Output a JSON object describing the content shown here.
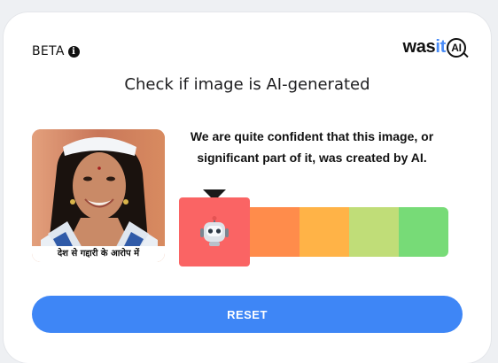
{
  "header": {
    "beta_label": "BETA",
    "info_icon": "info-icon",
    "logo_prefix": "was",
    "logo_accent": "it",
    "logo_badge": "AI"
  },
  "main": {
    "title": "Check if image is AI-generated",
    "photo_caption": "देश से गद्दारी के आरोप में",
    "verdict": "We are quite confident that this image, or significant part of it, was created by AI."
  },
  "scale": {
    "icon": "robot-icon",
    "active_segment": 0,
    "colors": [
      "#fa6464",
      "#ff8c4b",
      "#ffb347",
      "#c0dd78",
      "#77db77"
    ]
  },
  "actions": {
    "reset_label": "RESET"
  },
  "colors": {
    "accent": "#3e86f6",
    "logo_accent": "#4a8cf7"
  }
}
